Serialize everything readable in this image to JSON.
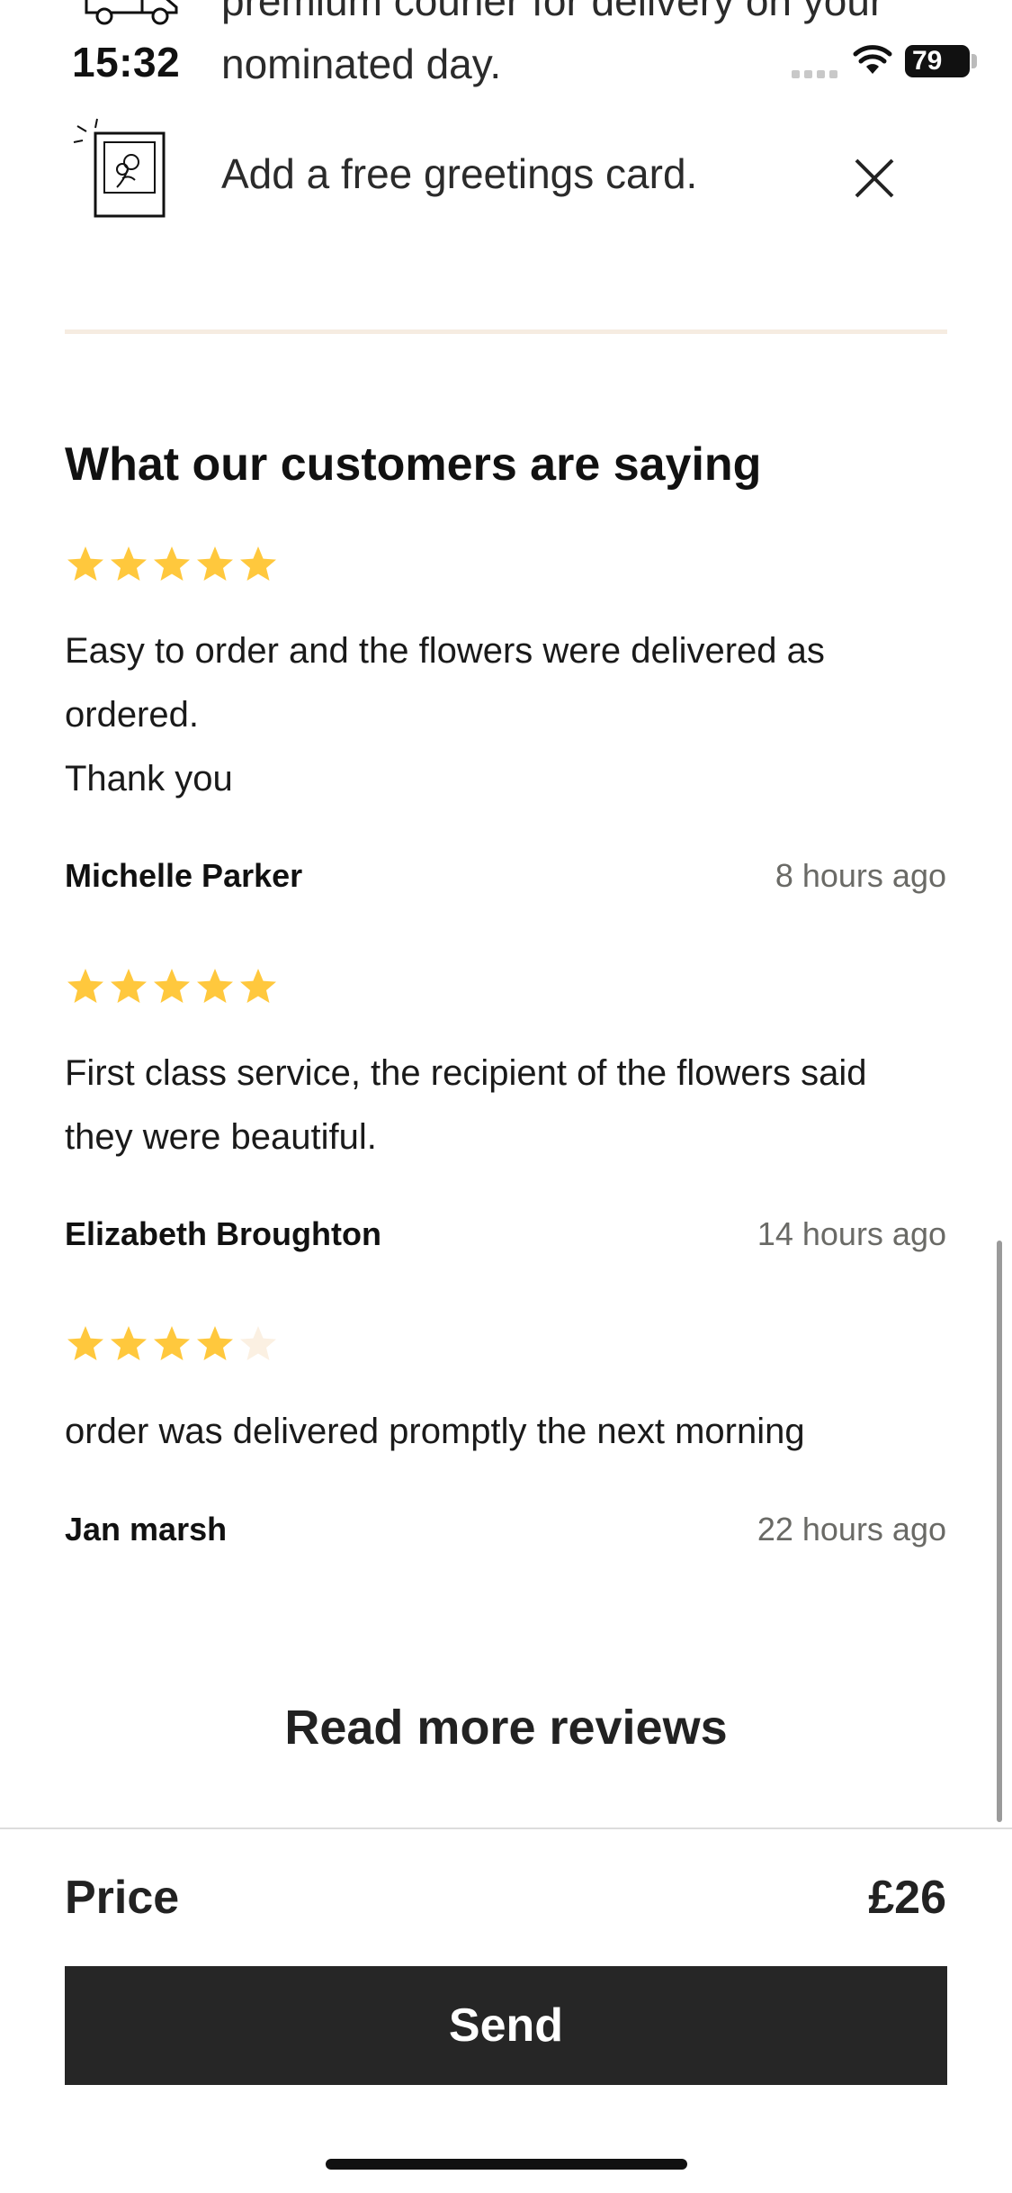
{
  "status_bar": {
    "time": "15:32",
    "battery": "79"
  },
  "options": {
    "delivery_text": "premium courier for delivery on your\nnominated day.",
    "greetings_card_text": "Add a free greetings card."
  },
  "reviews_section": {
    "title": "What our customers are saying",
    "reviews": [
      {
        "rating": 5,
        "text": "Easy to order and the flowers were delivered as\nordered.\nThank you",
        "author": "Michelle Parker",
        "time": "8 hours ago"
      },
      {
        "rating": 5,
        "text": "First class service, the recipient of the flowers said\nthey were beautiful.",
        "author": "Elizabeth Broughton",
        "time": "14 hours ago"
      },
      {
        "rating": 4,
        "text": "order was delivered promptly the next morning",
        "author": "Jan marsh",
        "time": "22 hours ago"
      }
    ],
    "read_more_label": "Read more reviews"
  },
  "footer": {
    "price_label": "Price",
    "price_value": "£26",
    "send_label": "Send"
  },
  "colors": {
    "star_filled": "#FFC83D",
    "star_empty": "#FBF0E2",
    "button_bg": "#262626",
    "divider": "#F6ECE1"
  }
}
